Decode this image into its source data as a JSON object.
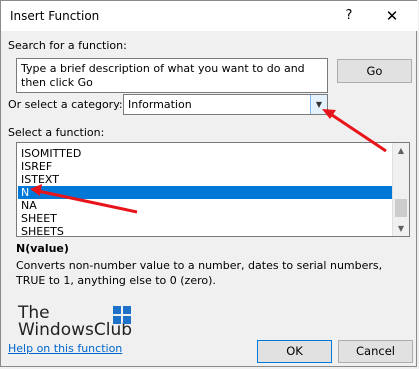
{
  "window": {
    "title": "Insert Function",
    "help_glyph": "?",
    "close_glyph": "✕"
  },
  "search": {
    "label": "Search for a function:",
    "value": "Type a brief description of what you want to do and then click Go",
    "go_label": "Go"
  },
  "category": {
    "label": "Or select a category:",
    "value": "Information"
  },
  "function_list": {
    "label": "Select a function:",
    "items": [
      "ISOMITTED",
      "ISREF",
      "ISTEXT",
      "N",
      "NA",
      "SHEET",
      "SHEETS"
    ],
    "selected": "N"
  },
  "details": {
    "syntax": "N(value)",
    "description": "Converts non-number value to a number, dates to serial numbers, TRUE to 1, anything else to 0 (zero)."
  },
  "watermark": {
    "line1": "The",
    "line2": "WindowsClub"
  },
  "footer": {
    "help_link": "Help on this function",
    "ok_label": "OK",
    "cancel_label": "Cancel"
  },
  "colors": {
    "selection": "#0078d7",
    "annotation_arrow": "#e8141b",
    "link": "#0066cc"
  }
}
